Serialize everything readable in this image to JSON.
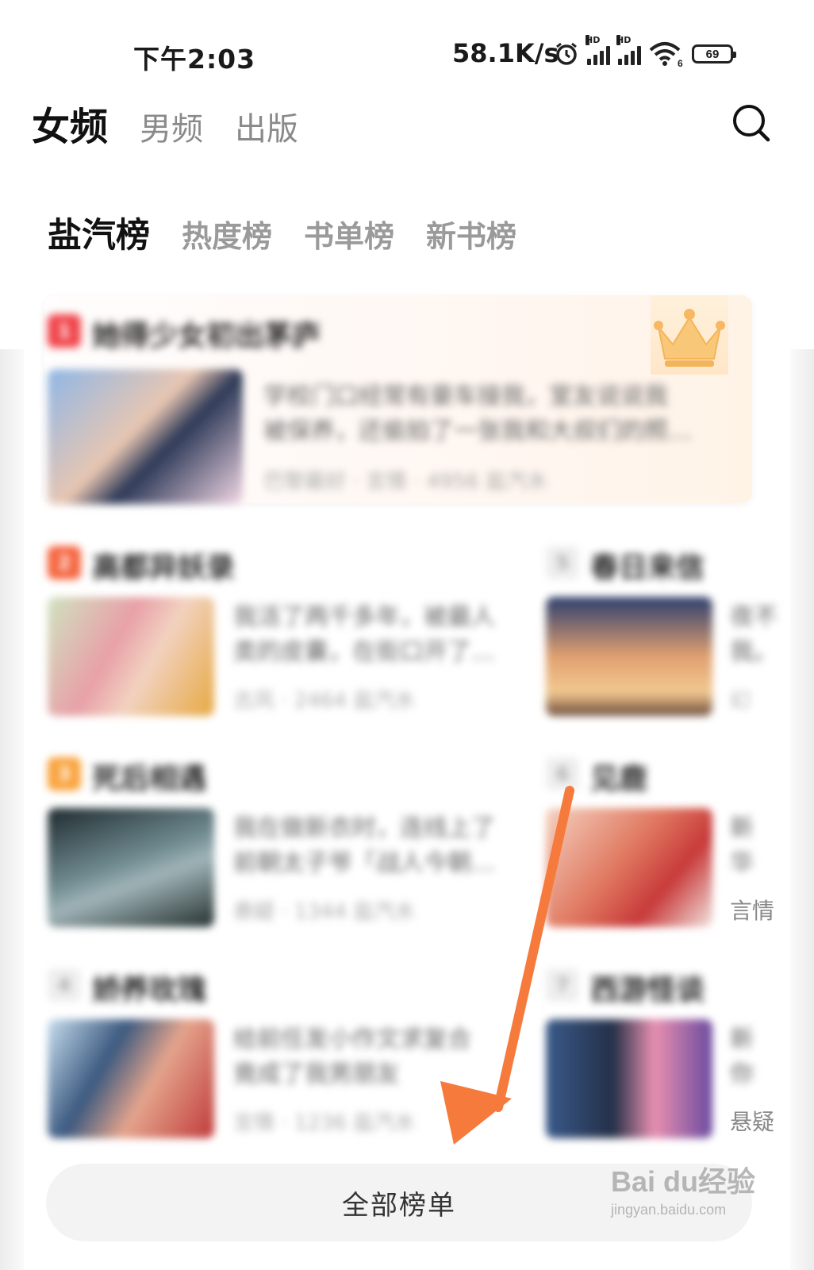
{
  "status_bar": {
    "time": "下午2:03",
    "net_speed": "58.1K/s",
    "battery": "69",
    "signal_label": "HD",
    "wifi_label": "6"
  },
  "main_tabs": [
    {
      "label": "女频"
    },
    {
      "label": "男频"
    },
    {
      "label": "出版"
    }
  ],
  "sub_tabs": [
    {
      "label": "盐汽榜"
    },
    {
      "label": "热度榜"
    },
    {
      "label": "书单榜"
    },
    {
      "label": "新书榜"
    }
  ],
  "rankings": [
    {
      "rank": "1",
      "title": "她得少女初出茅庐",
      "desc_line1": "学校门口经常有豪车接我，室友说说我",
      "desc_line2": "被保养，还偷拍了一张我和大叔们的照…",
      "meta": "巴黎最好 · 言情 · 4956 盐汽水"
    },
    {
      "rank": "2",
      "title": "高都异妖录",
      "desc_line1": "我活了两千多年，被最人",
      "desc_line2": "类的皮囊，在街口开了…",
      "meta": "古风 · 2464 盐汽水"
    },
    {
      "rank": "5",
      "title": "春日来信",
      "desc_line1": "夜不",
      "desc_line2": "我。",
      "meta": "幻"
    },
    {
      "rank": "3",
      "title": "死后相遇",
      "desc_line1": "我在做新衣时，连线上了",
      "desc_line2": "前朝太子爷「战人今朝…",
      "meta": "悬疑 · 1344 盐汽水"
    },
    {
      "rank": "6",
      "title": "见鹿",
      "desc_line1": "新",
      "desc_line2": "华",
      "meta": "言情"
    },
    {
      "rank": "4",
      "title": "娇养玫瑰",
      "desc_line1": "给前任发小作文求复合",
      "desc_line2": "竟成了我男朋友",
      "meta": "言情 · 1236 盐汽水"
    },
    {
      "rank": "7",
      "title": "西游怪谈",
      "desc_line1": "新",
      "desc_line2": "你",
      "meta": "悬疑"
    }
  ],
  "all_button": {
    "label": "全部榜单"
  },
  "watermark": {
    "brand": "Bai du经验",
    "url": "jingyan.baidu.com"
  },
  "colors": {
    "accent_pink": "#f7a8b4",
    "rank1": "#f0444a",
    "rank2": "#f5643e",
    "rank3": "#f9a23c",
    "arrow": "#f57a3c"
  }
}
